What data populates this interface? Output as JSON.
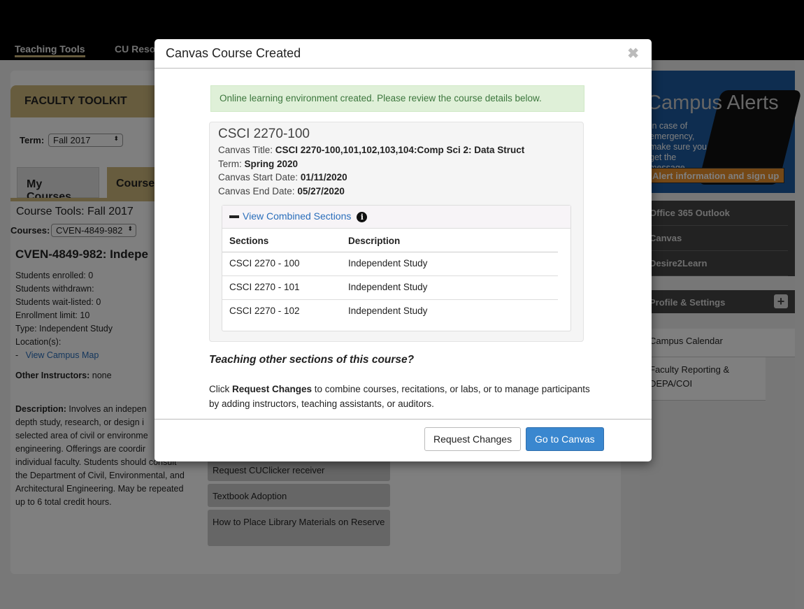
{
  "nav": {
    "items": [
      "Teaching Tools",
      "CU Reso"
    ]
  },
  "toolkit": {
    "title": "FACULTY TOOLKIT",
    "term_label": "Term:",
    "term_value": "Fall 2017",
    "tabs": [
      "My Courses",
      "Course"
    ],
    "course_tools": "Course Tools: Fall 2017",
    "courses_label": "Courses:",
    "courses_value": "CVEN-4849-982"
  },
  "course": {
    "heading": "CVEN-4849-982: Indepe",
    "lines": [
      "Students enrolled: 0",
      "Students withdrawn:",
      "Students wait-listed: 0",
      "Enrollment limit: 10",
      "Type: Independent Study",
      "Location(s):"
    ],
    "map_prefix": "-",
    "map_link": "View Campus Map",
    "instructors_label": "Other Instructors:",
    "instructors_value": "none",
    "desc_label": "Description:",
    "desc_lines": [
      " Involves an indepen",
      "depth study, research, or design i",
      "selected area of civil or environme",
      "engineering. Offerings are coordir",
      "individual faculty. Students should consult",
      "the Department of Civil, Environmental, and",
      "Architectural Engineering. May be repeated",
      "up to 6 total credit hours."
    ]
  },
  "tools": [
    "Request CUClicker receiver",
    "Textbook Adoption",
    "How to Place Library Materials on Reserve"
  ],
  "sidebar": {
    "alert_title": "Campus Alerts",
    "alert_text": "In case of emergency, make sure you get the message.",
    "alert_button": "Alert information and sign up",
    "links": [
      "Office 365 Outlook",
      "Canvas",
      "Desire2Learn"
    ],
    "profile": "Profile & Settings",
    "light_links": [
      "Campus Calendar",
      "Faculty Reporting & DEPA/COI"
    ]
  },
  "modal": {
    "title": "Canvas Course Created",
    "close": "✖",
    "success": "Online learning environment created. Please review the course details below.",
    "course_code": "CSCI 2270-100",
    "canvas_title_label": "Canvas Title: ",
    "canvas_title": "CSCI 2270-100,101,102,103,104:Comp Sci 2: Data Struct",
    "term_label": "Term: ",
    "term": "Spring 2020",
    "start_label": "Canvas Start Date: ",
    "start": "01/11/2020",
    "end_label": "Canvas End Date: ",
    "end": "05/27/2020",
    "accordion": "View Combined Sections",
    "info_icon": "i",
    "table": {
      "headers": [
        "Sections",
        "Description"
      ],
      "rows": [
        [
          "CSCI 2270 - 100",
          "Independent Study"
        ],
        [
          "CSCI 2270 - 101",
          "Independent Study"
        ],
        [
          "CSCI 2270 - 102",
          "Independent Study"
        ]
      ]
    },
    "question": "Teaching other sections of this course?",
    "help_pre": "Click ",
    "help_bold": "Request Changes",
    "help_post": " to combine courses, recitations, or labs, or to manage participants by adding instructors, teaching assistants, or auditors.",
    "request_button": "Request Changes",
    "canvas_button": "Go to Canvas"
  },
  "colors": {
    "gold": "#cfb87c",
    "primary": "#3a87cf",
    "success_bg": "#dff0d8",
    "success_text": "#3c763d"
  }
}
